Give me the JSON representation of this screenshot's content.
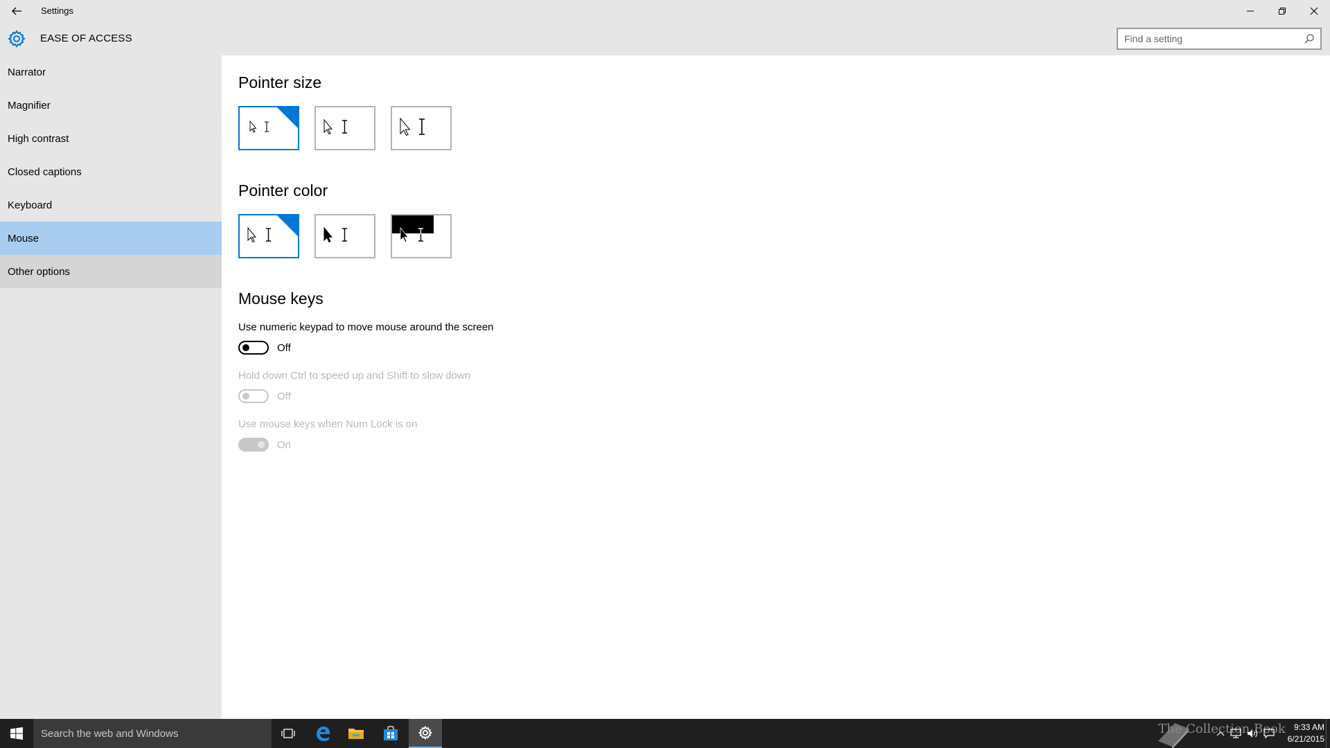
{
  "window": {
    "title": "Settings",
    "back_icon": "back-arrow-icon",
    "controls": [
      "minimize-icon",
      "restore-icon",
      "close-icon"
    ]
  },
  "header": {
    "icon": "gear-icon",
    "section_title": "EASE OF ACCESS",
    "search_placeholder": "Find a setting",
    "search_icon": "search-icon"
  },
  "sidebar": {
    "items": [
      {
        "label": "Narrator",
        "state": "normal"
      },
      {
        "label": "Magnifier",
        "state": "normal"
      },
      {
        "label": "High contrast",
        "state": "normal"
      },
      {
        "label": "Closed captions",
        "state": "normal"
      },
      {
        "label": "Keyboard",
        "state": "normal"
      },
      {
        "label": "Mouse",
        "state": "selected"
      },
      {
        "label": "Other options",
        "state": "hovered"
      }
    ]
  },
  "main": {
    "pointer_size": {
      "heading": "Pointer size",
      "options": [
        "small",
        "medium",
        "large"
      ],
      "selected_index": 0
    },
    "pointer_color": {
      "heading": "Pointer color",
      "options": [
        "white",
        "black",
        "inverted"
      ],
      "selected_index": 0
    },
    "mouse_keys": {
      "heading": "Mouse keys",
      "settings": [
        {
          "label": "Use numeric keypad to move mouse around the screen",
          "state_text": "Off",
          "enabled": true,
          "on": false
        },
        {
          "label": "Hold down Ctrl to speed up and Shift to slow down",
          "state_text": "Off",
          "enabled": false,
          "on": false
        },
        {
          "label": "Use mouse keys when Num Lock is on",
          "state_text": "On",
          "enabled": false,
          "on": true
        }
      ]
    }
  },
  "colors": {
    "accent": "#0078d7",
    "selected_nav": "#a8cdf0",
    "chrome_bg": "#e6e6e6",
    "taskbar_bg": "#1f1f1f"
  },
  "taskbar": {
    "search_placeholder": "Search the web and Windows",
    "icons": [
      "windows-start-icon",
      "task-view-icon",
      "edge-browser-icon",
      "file-explorer-icon",
      "store-icon",
      "settings-gear-icon"
    ],
    "watermark": "The Collection Book",
    "time": "9:33 AM",
    "date": "6/21/2015"
  }
}
